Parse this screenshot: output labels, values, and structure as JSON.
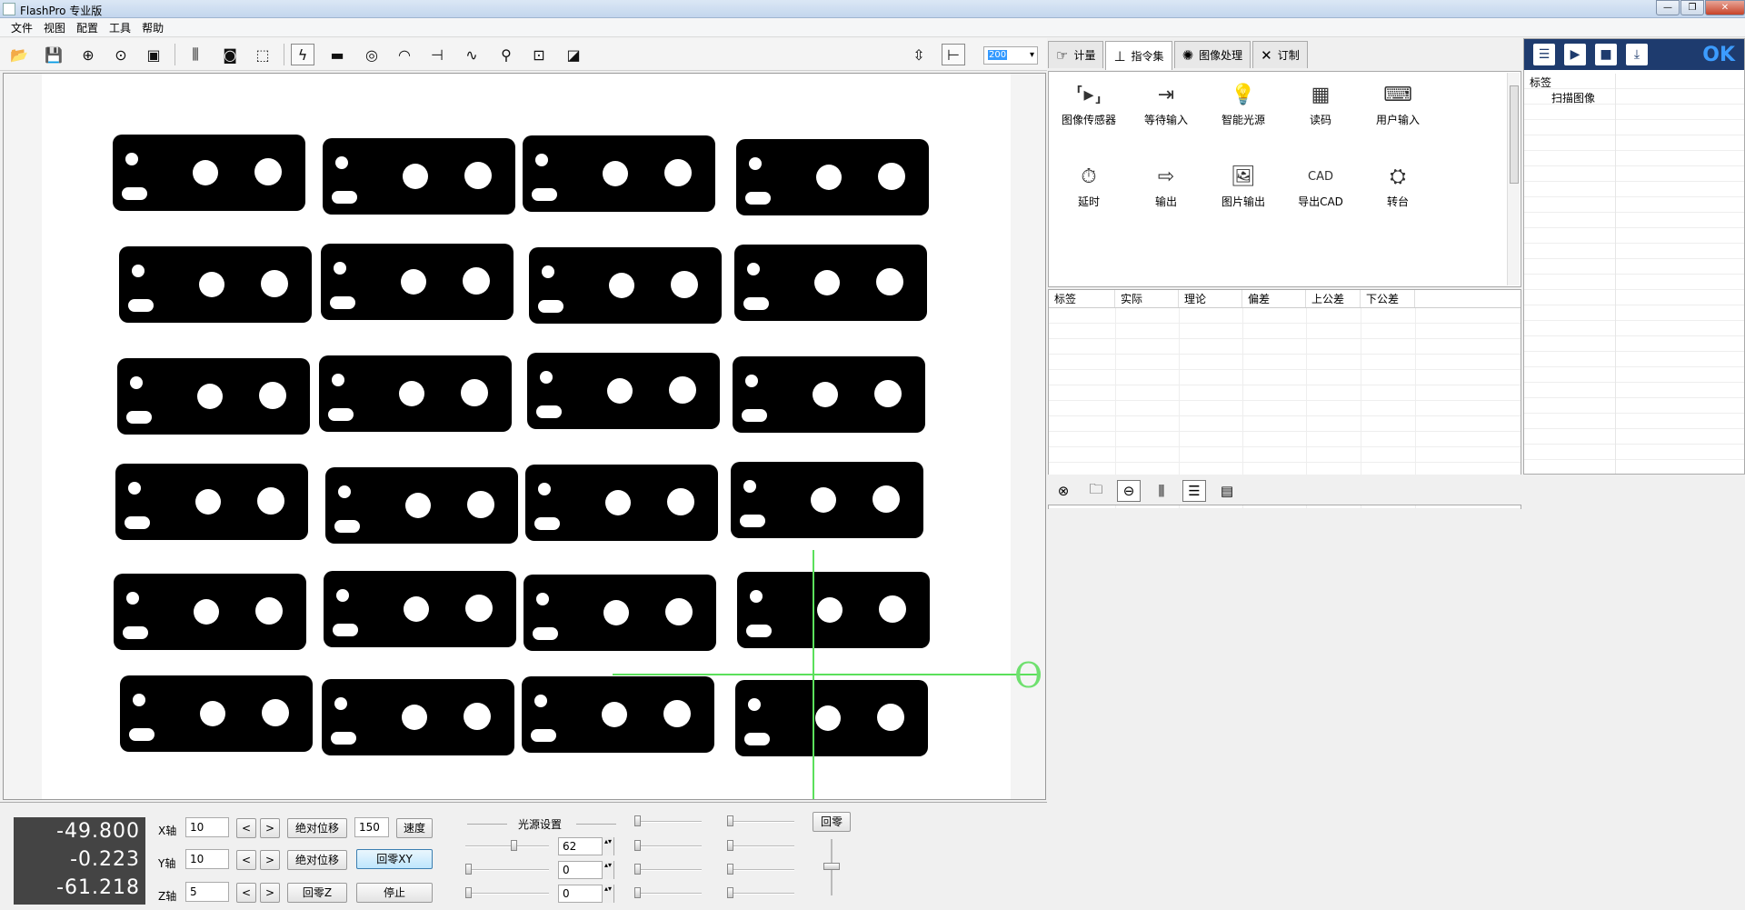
{
  "window": {
    "title": "FlashPro 专业版"
  },
  "menu": [
    "文件",
    "视图",
    "配置",
    "工具",
    "帮助"
  ],
  "toolbar": {
    "zoom_value": "200"
  },
  "readout": {
    "x": "-49.800",
    "y": "-0.223",
    "z": "-61.218"
  },
  "axes": {
    "x_label": "X轴",
    "y_label": "Y轴",
    "z_label": "Z轴",
    "x_value": "10",
    "y_value": "10",
    "z_value": "5",
    "prev": "<",
    "next": ">",
    "abs_move": "绝对位移",
    "speed_value": "150",
    "speed": "速度",
    "home_xy": "回零XY",
    "home_z": "回零Z",
    "stop": "停止"
  },
  "light": {
    "title": "光源设置",
    "values": [
      "62",
      "0",
      "0"
    ],
    "home": "回零"
  },
  "tabs": [
    {
      "label": "计量",
      "icon": "gauge-icon"
    },
    {
      "label": "指令集",
      "icon": "hierarchy-icon"
    },
    {
      "label": "图像处理",
      "icon": "aperture-icon"
    },
    {
      "label": "订制",
      "icon": "tools-icon"
    }
  ],
  "commands": [
    {
      "label": "图像传感器",
      "icon": "image-sensor-icon"
    },
    {
      "label": "等待输入",
      "icon": "wait-input-icon"
    },
    {
      "label": "智能光源",
      "icon": "bulb-icon"
    },
    {
      "label": "读码",
      "icon": "qr-code-icon"
    },
    {
      "label": "用户输入",
      "icon": "keyboard-icon"
    },
    {
      "label": "延时",
      "icon": "stopwatch-icon"
    },
    {
      "label": "输出",
      "icon": "output-icon"
    },
    {
      "label": "图片输出",
      "icon": "picture-icon"
    },
    {
      "label": "导出CAD",
      "icon": "cad-icon",
      "glyph": "CAD"
    },
    {
      "label": "转台",
      "icon": "turntable-icon"
    }
  ],
  "results_table": {
    "columns": [
      "标签",
      "实际",
      "理论",
      "偏差",
      "上公差",
      "下公差"
    ]
  },
  "program_list": {
    "header": "标签",
    "items": [
      "扫描图像"
    ],
    "ok": "OK"
  },
  "overlay_text": "O"
}
